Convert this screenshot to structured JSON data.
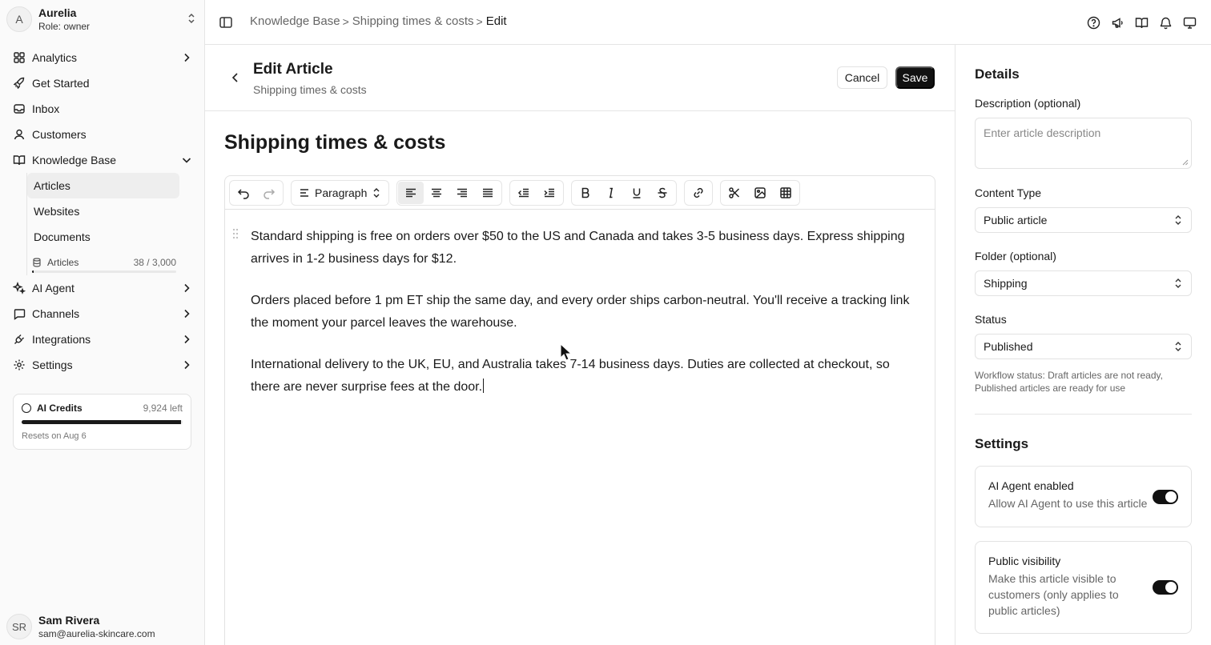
{
  "org": {
    "initial": "A",
    "name": "Aurelia",
    "role": "Role: owner"
  },
  "nav": {
    "analytics": "Analytics",
    "get_started": "Get Started",
    "inbox": "Inbox",
    "customers": "Customers",
    "knowledge_base": "Knowledge Base",
    "kb_items": [
      "Articles",
      "Websites",
      "Documents"
    ],
    "quota": {
      "label": "Articles",
      "value": "38 / 3,000",
      "used": 38,
      "limit": 3000
    },
    "ai_agent": "AI Agent",
    "channels": "Channels",
    "integrations": "Integrations",
    "settings": "Settings"
  },
  "credits": {
    "label": "AI Credits",
    "left": "9,924 left",
    "reset": "Resets on Aug 6",
    "fill_fraction": 0.99
  },
  "user": {
    "initials": "SR",
    "name": "Sam Rivera",
    "email": "sam@aurelia-skincare.com"
  },
  "breadcrumb": {
    "items": [
      "Knowledge Base",
      "Shipping times & costs"
    ],
    "current": "Edit",
    "separator": ">"
  },
  "header": {
    "title": "Edit Article",
    "subtitle": "Shipping times & costs",
    "cancel": "Cancel",
    "save": "Save"
  },
  "article": {
    "title": "Shipping times & costs",
    "paragraphs": [
      "Standard shipping is free on orders over $50 to the US and Canada and takes 3-5 business days. Express shipping arrives in 1-2 business days for $12.",
      "Orders placed before 1 pm ET ship the same day, and every order ships carbon-neutral. You'll receive a tracking link the moment your parcel leaves the warehouse.",
      "International delivery to the UK, EU, and Australia takes 7-14 business days. Duties are collected at checkout, so there are never surprise fees at the door."
    ]
  },
  "toolbar": {
    "block_type": "Paragraph"
  },
  "details": {
    "title": "Details",
    "description_label": "Description (optional)",
    "description_placeholder": "Enter article description",
    "content_type_label": "Content Type",
    "content_type_value": "Public article",
    "folder_label": "Folder (optional)",
    "folder_value": "Shipping",
    "status_label": "Status",
    "status_value": "Published",
    "status_help": "Workflow status: Draft articles are not ready, Published articles are ready for use"
  },
  "settings": {
    "title": "Settings",
    "ai_agent": {
      "title": "AI Agent enabled",
      "desc": "Allow AI Agent to use this article",
      "enabled": true
    },
    "public": {
      "title": "Public visibility",
      "desc": "Make this article visible to customers (only applies to public articles)",
      "enabled": true
    }
  }
}
